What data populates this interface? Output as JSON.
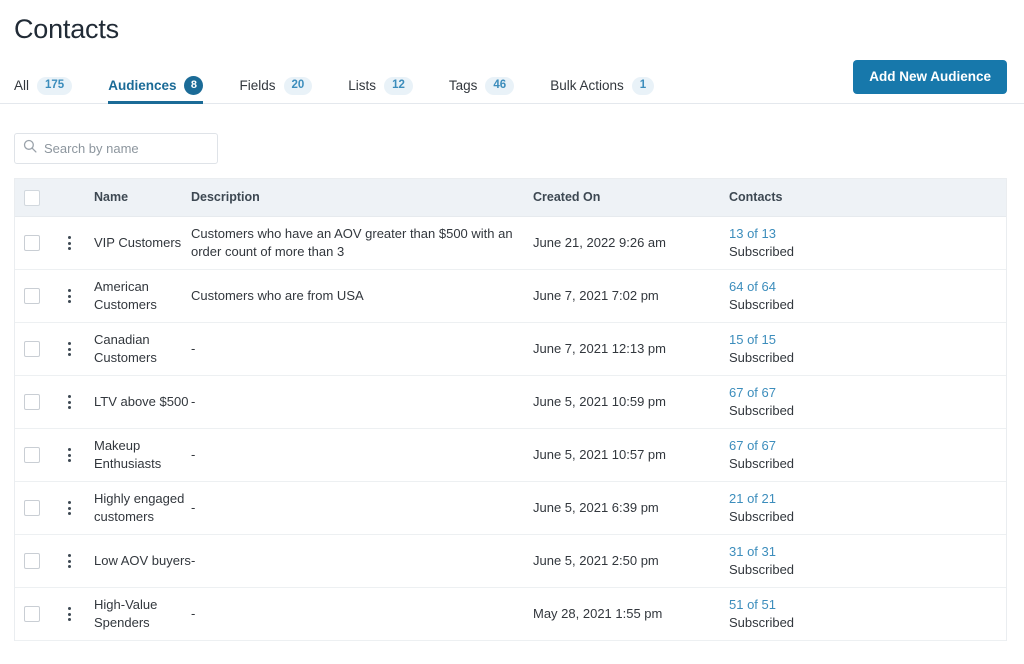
{
  "header": {
    "title": "Contacts",
    "primary_button": "Add New Audience"
  },
  "tabs": [
    {
      "label": "All",
      "badge": "175",
      "active": false
    },
    {
      "label": "Audiences",
      "badge": "8",
      "active": true
    },
    {
      "label": "Fields",
      "badge": "20",
      "active": false
    },
    {
      "label": "Lists",
      "badge": "12",
      "active": false
    },
    {
      "label": "Tags",
      "badge": "46",
      "active": false
    },
    {
      "label": "Bulk Actions",
      "badge": "1",
      "active": false
    }
  ],
  "search": {
    "placeholder": "Search by name",
    "value": "",
    "icon": "search-icon"
  },
  "table": {
    "columns": [
      "Name",
      "Description",
      "Created On",
      "Contacts"
    ],
    "rows": [
      {
        "name": "VIP Customers",
        "description": "Customers who have an AOV greater than $500 with an order count of more than 3",
        "created_on": "June 21, 2022 9:26 am",
        "contacts_count": "13 of 13",
        "contacts_status": "Subscribed",
        "checked": false
      },
      {
        "name": "American Customers",
        "description": "Customers who are from USA",
        "created_on": "June 7, 2021 7:02 pm",
        "contacts_count": "64 of 64",
        "contacts_status": "Subscribed",
        "checked": false
      },
      {
        "name": "Canadian Customers",
        "description": "-",
        "created_on": "June 7, 2021 12:13 pm",
        "contacts_count": "15 of 15",
        "contacts_status": "Subscribed",
        "checked": false
      },
      {
        "name": "LTV above $500",
        "description": "-",
        "created_on": "June 5, 2021 10:59 pm",
        "contacts_count": "67 of 67",
        "contacts_status": "Subscribed",
        "checked": false
      },
      {
        "name": "Makeup Enthusiasts",
        "description": "-",
        "created_on": "June 5, 2021 10:57 pm",
        "contacts_count": "67 of 67",
        "contacts_status": "Subscribed",
        "checked": false
      },
      {
        "name": "Highly engaged customers",
        "description": "-",
        "created_on": "June 5, 2021 6:39 pm",
        "contacts_count": "21 of 21",
        "contacts_status": "Subscribed",
        "checked": false
      },
      {
        "name": "Low AOV buyers",
        "description": "-",
        "created_on": "June 5, 2021 2:50 pm",
        "contacts_count": "31 of 31",
        "contacts_status": "Subscribed",
        "checked": false
      },
      {
        "name": "High-Value Spenders",
        "description": "-",
        "created_on": "May 28, 2021 1:55 pm",
        "contacts_count": "51 of 51",
        "contacts_status": "Subscribed",
        "checked": false
      }
    ]
  },
  "colors": {
    "accent": "#1778ab",
    "link": "#3c8dbc",
    "active_tab": "#1b6b97",
    "text": "#32373d",
    "header_bg": "#eef2f6"
  }
}
